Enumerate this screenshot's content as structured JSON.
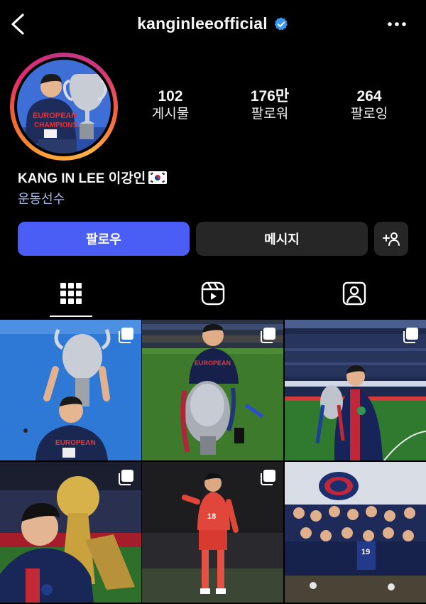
{
  "header": {
    "username": "kanginleeofficial",
    "verified": true
  },
  "profile": {
    "stats": [
      {
        "value": "102",
        "label": "게시물"
      },
      {
        "value": "176만",
        "label": "팔로워"
      },
      {
        "value": "264",
        "label": "팔로잉"
      }
    ],
    "display_name": "KANG IN LEE 이강인",
    "flag": "south-korea-flag",
    "category": "운동선수"
  },
  "actions": {
    "follow_label": "팔로우",
    "message_label": "메시지",
    "add_person_icon": "add-person-icon"
  },
  "tabs": [
    {
      "icon": "grid-icon",
      "active": true
    },
    {
      "icon": "reels-icon",
      "active": false
    },
    {
      "icon": "tagged-icon",
      "active": false
    }
  ],
  "posts": [
    {
      "type": "carousel",
      "scene": "trophy-overhead-blue-wall"
    },
    {
      "type": "carousel",
      "scene": "crouching-with-trophy-pitch"
    },
    {
      "type": "carousel",
      "scene": "stadium-with-trophy"
    },
    {
      "type": "carousel",
      "scene": "selfie-with-trophy"
    },
    {
      "type": "carousel",
      "scene": "national-team-red-kit"
    },
    {
      "type": "photo",
      "scene": "team-locker-room"
    }
  ],
  "colors": {
    "accent": "#4a5ef5",
    "verified": "#3897f0",
    "secondary_button": "#262626",
    "category_text": "#a8b8e8"
  }
}
